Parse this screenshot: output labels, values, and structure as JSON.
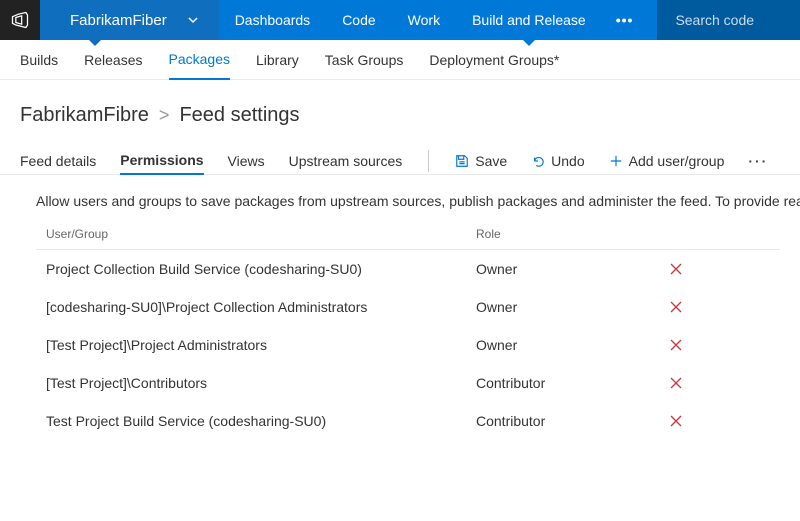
{
  "topbar": {
    "project_name": "FabrikamFiber",
    "nav": [
      {
        "label": "Dashboards"
      },
      {
        "label": "Code"
      },
      {
        "label": "Work"
      },
      {
        "label": "Build and Release"
      }
    ],
    "search_placeholder": "Search code"
  },
  "subnav": {
    "items": [
      {
        "label": "Builds"
      },
      {
        "label": "Releases"
      },
      {
        "label": "Packages"
      },
      {
        "label": "Library"
      },
      {
        "label": "Task Groups"
      },
      {
        "label": "Deployment Groups*"
      }
    ]
  },
  "breadcrumb": {
    "root": "FabrikamFibre",
    "leaf": "Feed settings"
  },
  "page_tabs": [
    {
      "label": "Feed details"
    },
    {
      "label": "Permissions"
    },
    {
      "label": "Views"
    },
    {
      "label": "Upstream sources"
    }
  ],
  "actions": {
    "save": "Save",
    "undo": "Undo",
    "add": "Add user/group"
  },
  "description": "Allow users and groups to save packages from upstream sources, publish packages and administer the feed. To provide read",
  "table": {
    "headers": {
      "user_group": "User/Group",
      "role": "Role"
    },
    "rows": [
      {
        "user_group": "Project Collection Build Service (codesharing-SU0)",
        "role": "Owner"
      },
      {
        "user_group": "[codesharing-SU0]\\Project Collection Administrators",
        "role": "Owner"
      },
      {
        "user_group": "[Test Project]\\Project Administrators",
        "role": "Owner"
      },
      {
        "user_group": "[Test Project]\\Contributors",
        "role": "Contributor"
      },
      {
        "user_group": "Test Project Build Service (codesharing-SU0)",
        "role": "Contributor"
      }
    ]
  }
}
